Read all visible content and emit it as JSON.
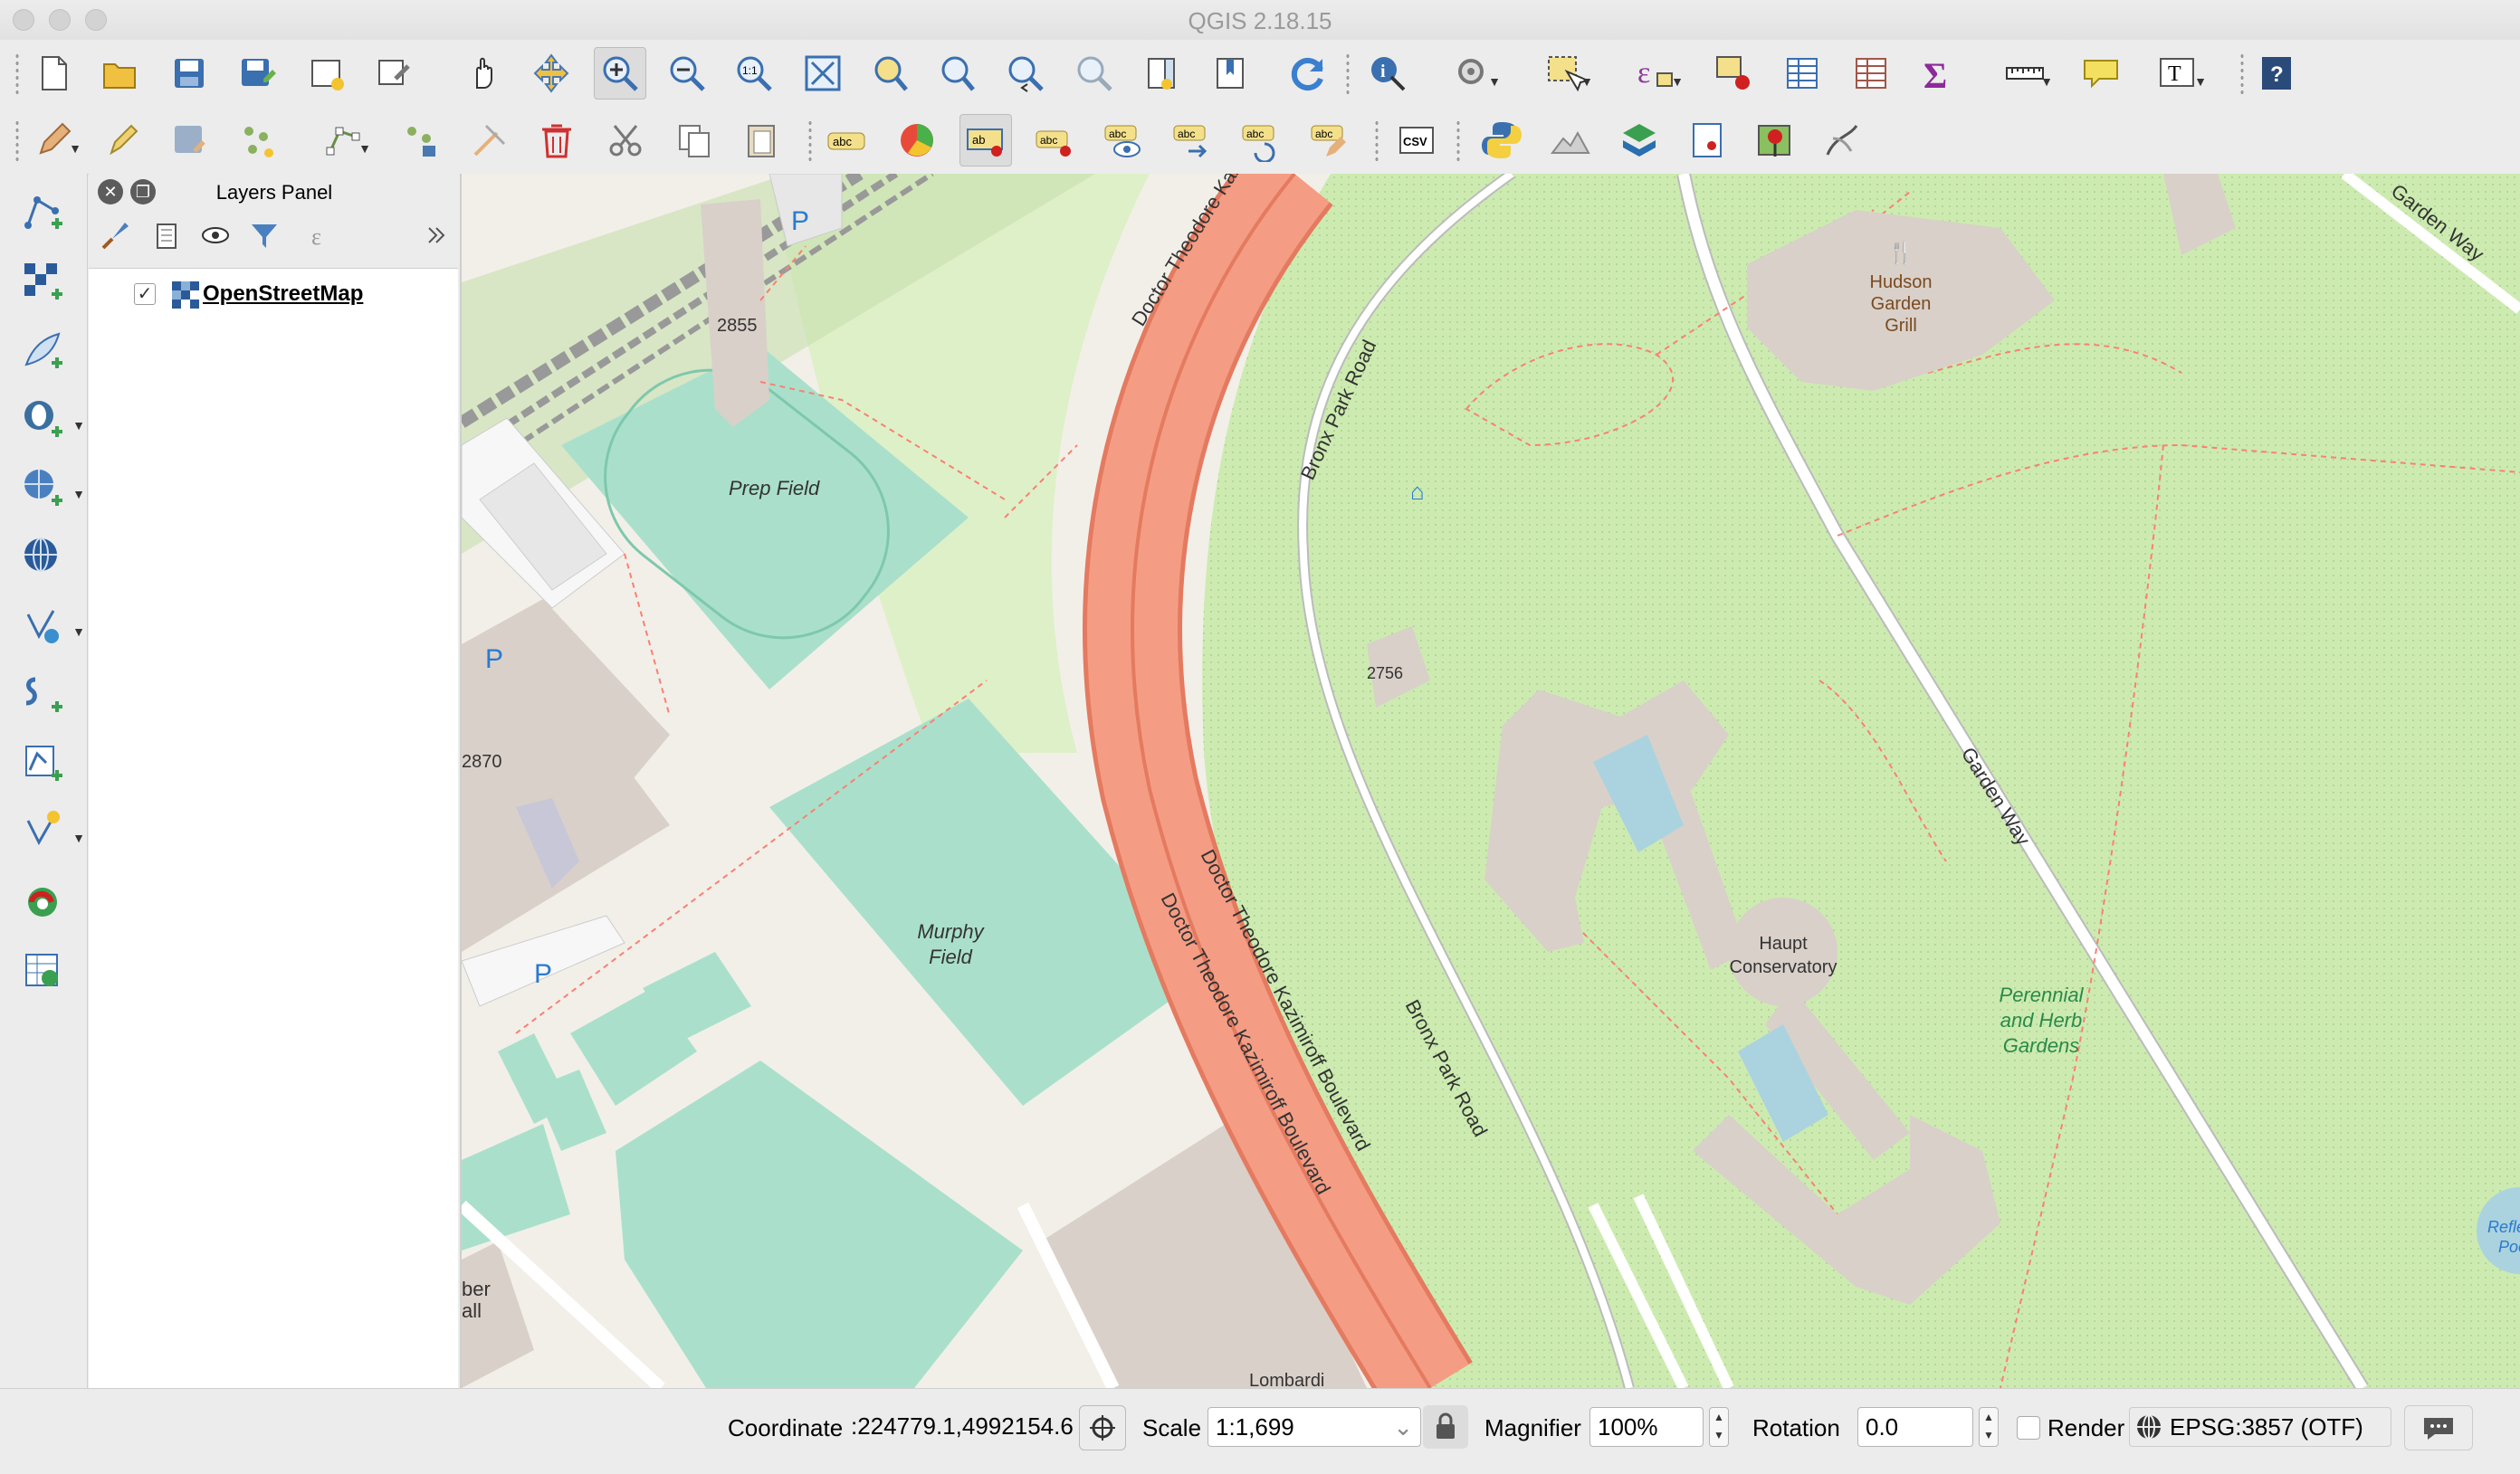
{
  "window": {
    "title": "QGIS 2.18.15"
  },
  "layers_panel": {
    "title": "Layers Panel",
    "layers": [
      {
        "name": "OpenStreetMap",
        "checked": true
      }
    ]
  },
  "map": {
    "labels": {
      "prep_field": "Prep Field",
      "murphy_field_1": "Murphy",
      "murphy_field_2": "Field",
      "num_2855": "2855",
      "num_2870": "2870",
      "num_2756": "2756",
      "doctor_top": "Doctor Theodore Kaz",
      "doctor_1": "Doctor Theodore Kazimiroff Boulevard",
      "doctor_2": "Doctor Theodore Kazimiroff Boulevard",
      "bronx_top": "Bronx Park Road",
      "bronx_bottom": "Bronx Park Road",
      "garden_way_top": "Garden Way",
      "garden_way_mid": "Garden Way",
      "hudson_1": "Hudson",
      "hudson_2": "Garden",
      "hudson_3": "Grill",
      "haupt_1": "Haupt",
      "haupt_2": "Conservatory",
      "perennial_1": "Perennial",
      "perennial_2": "and Herb",
      "perennial_3": "Gardens",
      "reflect_1": "Reflec",
      "reflect_2": "Poo",
      "lombardi": "Lombardi",
      "ber": "ber",
      "all": "all",
      "parking": "P"
    }
  },
  "statusbar": {
    "coordinate_label": "Coordinate",
    "coordinate_value": ":224779.1,4992154.6",
    "scale_label": "Scale",
    "scale_value": "1:1,699",
    "magnifier_label": "Magnifier",
    "magnifier_value": "100%",
    "rotation_label": "Rotation",
    "rotation_value": "0.0",
    "render_label": "Render",
    "render_checked": false,
    "crs": "EPSG:3857 (OTF)"
  },
  "colors": {
    "park_green": "#cdebb0",
    "pitch": "#aae0cb",
    "building": "#d9d0c9",
    "primary_road": "#f49d84",
    "water": "#aad3df",
    "background": "#f2efe9"
  }
}
